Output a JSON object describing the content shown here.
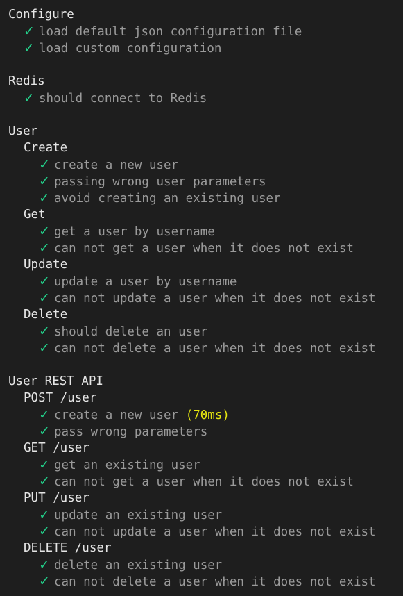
{
  "check_glyph": "✓",
  "colors": {
    "background": "#1e1e1e",
    "suite_text": "#e5e5e5",
    "test_text": "#9a9a9a",
    "pass_check": "#23d18b",
    "duration": "#e5e510"
  },
  "suites": [
    {
      "title": "Configure",
      "tests": [
        {
          "title": "load default json configuration file"
        },
        {
          "title": "load custom configuration"
        }
      ]
    },
    {
      "title": "Redis",
      "tests": [
        {
          "title": "should connect to Redis"
        }
      ]
    },
    {
      "title": "User",
      "subsuites": [
        {
          "title": "Create",
          "tests": [
            {
              "title": "create a new user"
            },
            {
              "title": "passing wrong user parameters"
            },
            {
              "title": "avoid creating an existing user"
            }
          ]
        },
        {
          "title": "Get",
          "tests": [
            {
              "title": "get a user by username"
            },
            {
              "title": "can not get a user when it does not exist"
            }
          ]
        },
        {
          "title": "Update",
          "tests": [
            {
              "title": "update a user by username"
            },
            {
              "title": "can not update a user when it does not exist"
            }
          ]
        },
        {
          "title": "Delete",
          "tests": [
            {
              "title": "should delete an user"
            },
            {
              "title": "can not delete a user when it does not exist"
            }
          ]
        }
      ]
    },
    {
      "title": "User REST API",
      "subsuites": [
        {
          "title": "POST /user",
          "tests": [
            {
              "title": "create a new user",
              "duration": "(70ms)"
            },
            {
              "title": "pass wrong parameters"
            }
          ]
        },
        {
          "title": "GET /user",
          "tests": [
            {
              "title": "get an existing user"
            },
            {
              "title": "can not get a user when it does not exist"
            }
          ]
        },
        {
          "title": "PUT /user",
          "tests": [
            {
              "title": "update an existing user"
            },
            {
              "title": "can not update a user when it does not exist"
            }
          ]
        },
        {
          "title": "DELETE /user",
          "tests": [
            {
              "title": "delete an existing user"
            },
            {
              "title": "can not delete a user when it does not exist"
            }
          ]
        }
      ]
    }
  ]
}
